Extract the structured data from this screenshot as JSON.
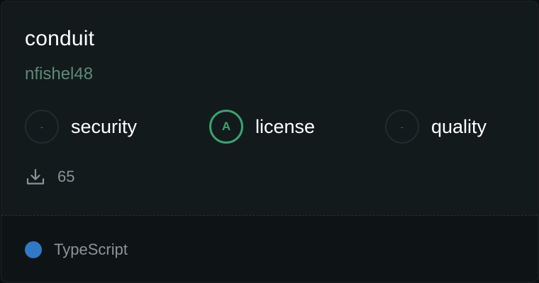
{
  "repo": {
    "name": "conduit",
    "owner": "nfishel48"
  },
  "scores": [
    {
      "label": "security",
      "grade": "-"
    },
    {
      "label": "license",
      "grade": "A"
    },
    {
      "label": "quality",
      "grade": "-"
    }
  ],
  "stats": {
    "downloads": "65",
    "downloads_icon": "download-icon"
  },
  "language": {
    "name": "TypeScript",
    "color": "#3178c6"
  },
  "colors": {
    "grade_a": "#3aa36d",
    "owner_text": "#5d8a74"
  }
}
